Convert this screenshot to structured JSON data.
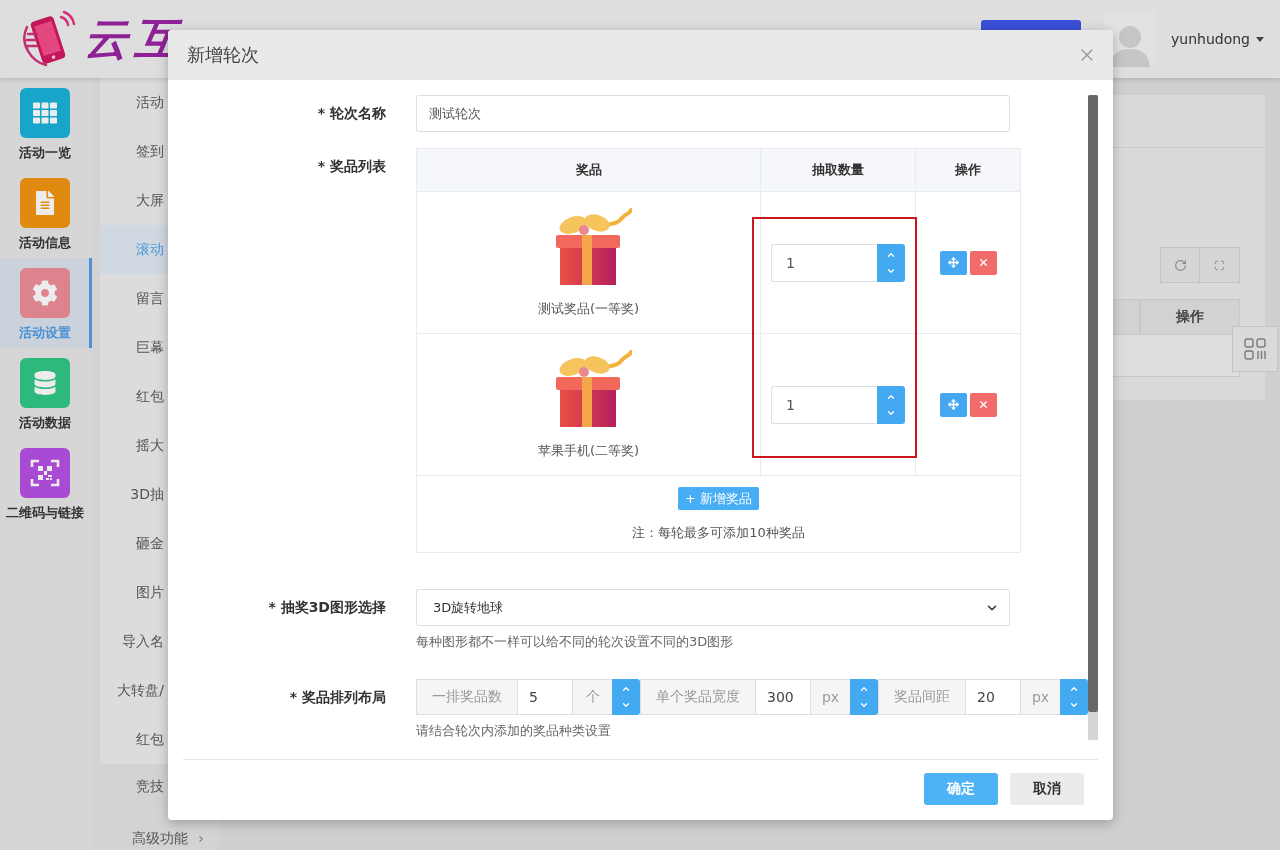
{
  "header": {
    "logo_text": "云互",
    "username": "yunhudong"
  },
  "nav": [
    {
      "label": "活动一览",
      "color": "#17a6c9",
      "selected": false
    },
    {
      "label": "活动信息",
      "color": "#e08b0f",
      "selected": false
    },
    {
      "label": "活动设置",
      "color": "#dc838d",
      "selected": true
    },
    {
      "label": "活动数据",
      "color": "#2db97b",
      "selected": false
    },
    {
      "label": "二维码与链接",
      "color": "#a84ad4",
      "selected": false
    }
  ],
  "submenu": {
    "panel_items": [
      {
        "label": "活动",
        "selected": false
      },
      {
        "label": "签到",
        "selected": false
      },
      {
        "label": "大屏",
        "selected": false
      },
      {
        "label": "滚动",
        "selected": true
      },
      {
        "label": "留言",
        "selected": false
      },
      {
        "label": "巨幕",
        "selected": false
      },
      {
        "label": "红包",
        "selected": false
      },
      {
        "label": "摇大",
        "selected": false
      },
      {
        "label": "3D抽",
        "selected": false
      },
      {
        "label": "砸金",
        "selected": false
      },
      {
        "label": "图片",
        "selected": false
      },
      {
        "label": "导入名",
        "selected": false
      },
      {
        "label": "大转盘/",
        "selected": false
      },
      {
        "label": "红包",
        "selected": false
      }
    ],
    "items": [
      {
        "label": "竞技",
        "expandable": false
      },
      {
        "label": "高级功能",
        "expandable": true
      }
    ]
  },
  "background_table": {
    "column_header": "操作"
  },
  "dialog": {
    "title": "新增轮次",
    "round_name": {
      "label": "* 轮次名称",
      "value": "测试轮次"
    },
    "prize_list": {
      "label": "* 奖品列表",
      "columns": [
        "奖品",
        "抽取数量",
        "操作"
      ],
      "rows": [
        {
          "name": "测试奖品(一等奖)",
          "quantity": "1"
        },
        {
          "name": "苹果手机(二等奖)",
          "quantity": "1"
        }
      ],
      "quantity_highlighted": true,
      "add_button": "+ 新增奖品",
      "note": "注：每轮最多可添加10种奖品"
    },
    "shape": {
      "label": "* 抽奖3D图形选择",
      "value": "3D旋转地球",
      "hint": "每种图形都不一样可以给不同的轮次设置不同的3D图形"
    },
    "layout": {
      "label": "* 奖品排列布局",
      "groups": [
        {
          "label": "一排奖品数",
          "value": "5",
          "unit": "个"
        },
        {
          "label": "单个奖品宽度",
          "value": "300",
          "unit": "px"
        },
        {
          "label": "奖品间距",
          "value": "20",
          "unit": "px"
        }
      ],
      "hint": "请结合轮次内添加的奖品种类设置"
    },
    "buttons": [
      {
        "label": "确定",
        "kind": "primary"
      },
      {
        "label": "取消",
        "kind": "secondary"
      }
    ]
  }
}
